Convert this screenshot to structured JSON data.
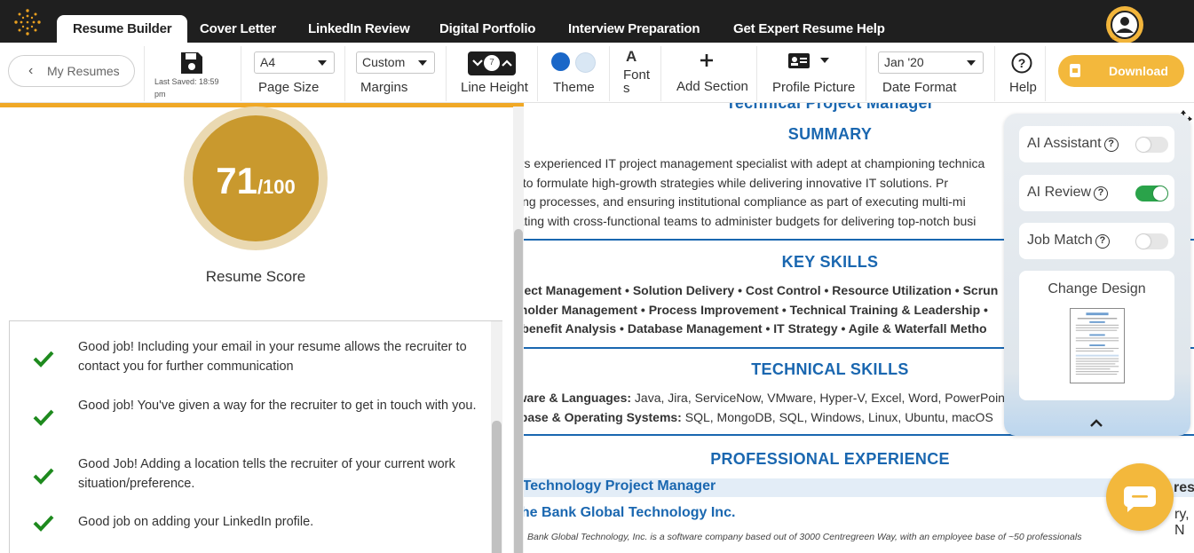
{
  "nav": {
    "tabs": [
      "Resume Builder",
      "Cover Letter",
      "LinkedIn Review",
      "Digital Portfolio",
      "Interview Preparation",
      "Get Expert Resume Help"
    ]
  },
  "toolbar": {
    "my_resumes": "My Resumes",
    "last_saved": "Last Saved: 18:59 pm",
    "page_size_value": "A4",
    "page_size_label": "Page Size",
    "margins_value": "Custom",
    "margins_label": "Margins",
    "line_height_value": "7",
    "line_height_label": "Line Height",
    "theme_label": "Theme",
    "theme_colors": [
      "#1a67c8",
      "#d9e7f4"
    ],
    "fonts_glyph": "A",
    "fonts_label": "Fonts",
    "add_section_label": "Add Section",
    "profile_picture_label": "Profile Picture",
    "date_format_value": "Jan '20",
    "date_format_label": "Date Format",
    "help_label": "Help",
    "download_label": "Download"
  },
  "score": {
    "value": "71",
    "max": "/100",
    "label": "Resume Score"
  },
  "checklist": [
    "Good job! Including your email in your resume allows the recruiter to contact you for further communication",
    "Good job! You've given a way for the recruiter to get in touch with you.",
    "Good Job! Adding a location tells the recruiter of your current work situation/preference.",
    "Good job on adding your LinkedIn profile."
  ],
  "resume": {
    "headline": "Technical Project Manager",
    "summary_title": "SUMMARY",
    "summary_lines": [
      "ars experienced IT project management specialist with adept at championing technica",
      "s to formulate high-growth strategies while delivering innovative IT solutions. Pr",
      "xing processes, and ensuring institutional compliance as part of executing multi-mi",
      "rating with cross-functional teams to administer budgets for delivering top-notch busi"
    ],
    "key_skills_title": "KEY SKILLS",
    "key_skills_lines": [
      "oject Management • Solution Delivery • Cost Control • Resource Utilization • Scrun",
      "eholder Management • Process Improvement • Technical Training & Leadership •",
      "t-benefit Analysis • Database Management • IT Strategy • Agile & Waterfall Metho"
    ],
    "tech_skills_title": "TECHNICAL SKILLS",
    "tech_skills": [
      {
        "label": "tware & Languages:",
        "value": " Java, Jira, ServiceNow, VMware, Hyper-V, Excel, Word, PowerPoint"
      },
      {
        "label": "abase & Operating Systems:",
        "value": " SQL, MongoDB, SQL, Windows, Linux, Ubuntu, macOS"
      }
    ],
    "experience_title": "PROFESSIONAL EXPERIENCE",
    "job_title": "r Technology Project Manager",
    "company": "che Bank Global Technology Inc.",
    "company_desc": "Bank Global Technology, Inc. is a software company based out of 3000 Centregreen Way, with an employee base of ~50 professionals",
    "edge_right_1": "res",
    "edge_right_2": "ry, N"
  },
  "ai_panel": {
    "assistant_label": "AI Assistant",
    "assistant_on": false,
    "review_label": "AI Review",
    "review_on": true,
    "job_match_label": "Job Match",
    "job_match_on": false,
    "change_design_label": "Change Design"
  },
  "colors": {
    "accent": "#f3b83c",
    "brand_blue": "#1a67b0",
    "score_gold": "#c9992e",
    "check_green": "#1e8a1e"
  }
}
